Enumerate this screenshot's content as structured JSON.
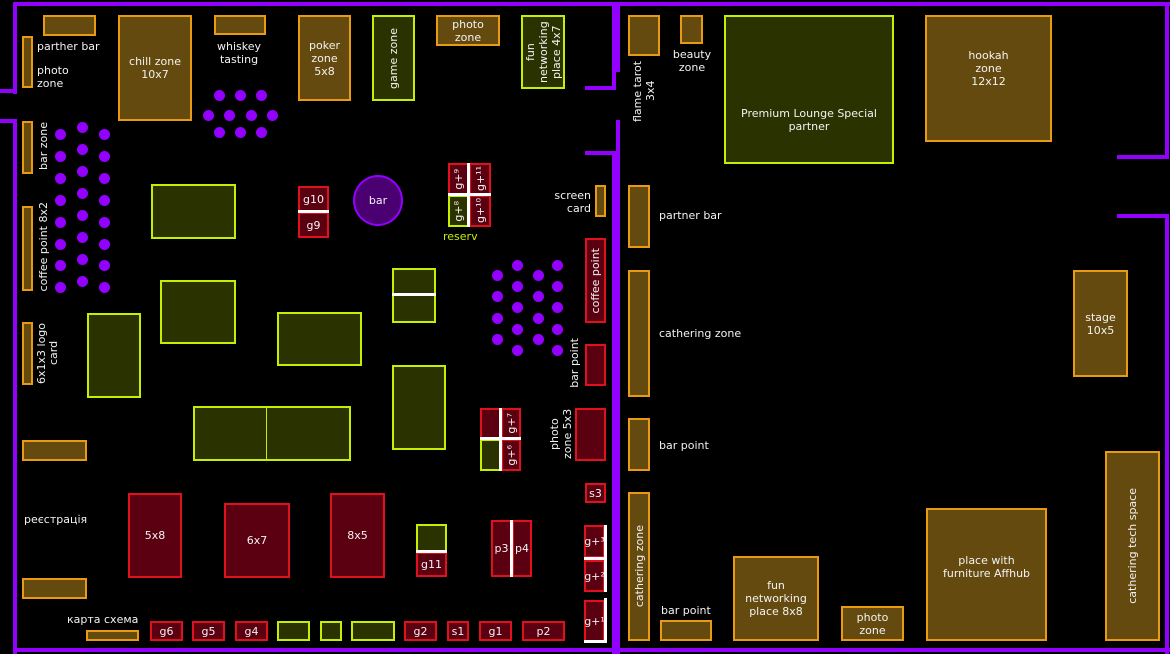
{
  "colors": {
    "walls": "#9400ff",
    "partner_zone": "#654a10",
    "green_zone": "#2a3300",
    "reserved_red": "#5a0010",
    "bar": "#4a0070",
    "reserv_text": "#c6ee00"
  },
  "left_hall": {
    "parther_bar": "parther bar",
    "photo_zone_left": "photo zone",
    "chill_zone": "chill zone 10x7",
    "whiskey": "whiskey tasting",
    "poker": "poker zone 5x8",
    "game_zone": "game zone",
    "photo_zone_top": "photo zone",
    "fun_networking": "fun networking place 4x7",
    "bar_zone": "bar zone",
    "coffee_point_8x2": "coffee point 8x2",
    "logo_card": "6x1x3 logo card",
    "registration": "реєстрація",
    "map": "карта схема",
    "bar": "bar",
    "reserv": "reserv",
    "screen_card": "screen card",
    "coffee_point": "coffee point",
    "bar_point": "bar point",
    "photo_zone_5x3": "photo zone 5x3",
    "tables": {
      "g10": "g10",
      "g9": "g9",
      "g+9": "g+⁹",
      "g+11": "g+¹¹",
      "g+8": "g+⁸",
      "g+10": "g+¹⁰",
      "g+7": "g+⁷",
      "g+6": "g+⁶",
      "s3": "s3",
      "z5x8": "5x8",
      "z6x7": "6x7",
      "z8x5": "8x5",
      "g11": "g11",
      "p3": "p3",
      "p4": "p4",
      "g+3": "g+³",
      "g+2": "g+²",
      "g+1": "g+¹",
      "g6": "g6",
      "g5": "g5",
      "g4": "g4",
      "g2": "g2",
      "s1": "s1",
      "g1": "g1",
      "p2": "p2"
    }
  },
  "right_hall": {
    "flame_tarot": "flame tarot 3x4",
    "beauty": "beauty zone",
    "premium": "Premium Lounge Special partner",
    "hookah": "hookah zone 12x12",
    "partner_bar": "partner bar",
    "cathering": "cathering zone",
    "bar_point": "bar point",
    "cathering_v": "cathering zone",
    "bar_point_bottom": "bar point",
    "fun_networking": "fun networking place 8x8",
    "photo_zone": "photo zone",
    "furniture": "place with furniture Affhub",
    "stage": "stage 10x5",
    "tech_space": "cathering tech space"
  }
}
